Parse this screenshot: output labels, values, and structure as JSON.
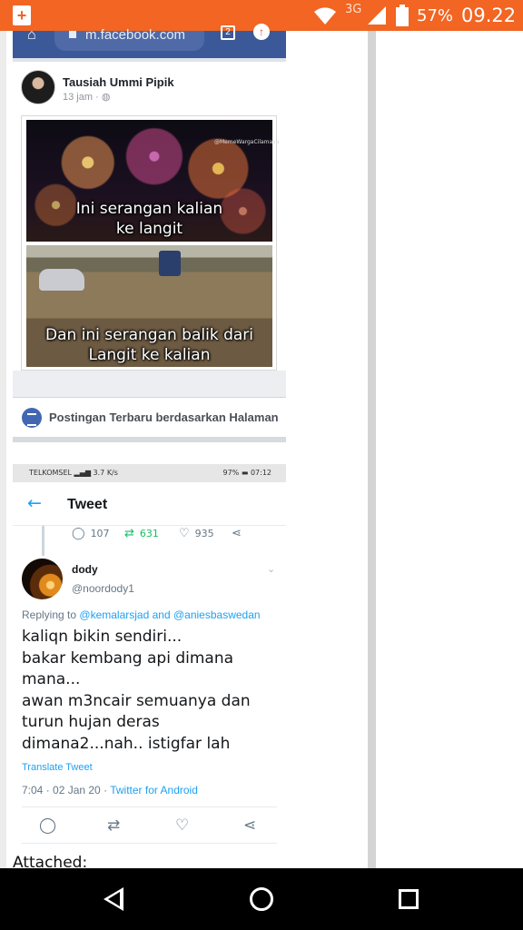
{
  "status_bar": {
    "network_type": "3G",
    "battery_percent": "57%",
    "time": "09.22"
  },
  "browser": {
    "url": "m.facebook.com",
    "tab_count": "2"
  },
  "post": {
    "author": "Tausiah Ummi Pipik",
    "time": "13 jam ·",
    "meme": {
      "watermark": "@MemeWargaCilamaya",
      "top_caption_line1": "Ini serangan kalian",
      "top_caption_line2": "ke langit",
      "bottom_caption_line1": "Dan ini serangan balik dari",
      "bottom_caption_line2": "Langit ke kalian"
    }
  },
  "recent_posts_label": "Postingan Terbaru berdasarkan Halaman",
  "tweet_screenshot": {
    "status": {
      "carrier": "TELKOMSEL",
      "speed": "3.7 K/s",
      "battery": "97%",
      "time": "07:12"
    },
    "header_title": "Tweet",
    "parent_stats": {
      "replies": "107",
      "retweets": "631",
      "likes": "935"
    },
    "author_name": "dody",
    "author_handle": "@noordody1",
    "replying_prefix": "Replying to",
    "mention_1": "@kemalarsjad",
    "replying_and": "and",
    "mention_2": "@aniesbaswedan",
    "body": "kaliqn bikin sendiri...\nbakar kembang api dimana mana...\nawan m3ncair semuanya dan turun hujan deras dimana2...nah.. istigfar lah",
    "translate_label": "Translate Tweet",
    "timestamp": "7:04 · 02 Jan 20 ·",
    "client": "Twitter for Android",
    "accent_color": "#1da1f2",
    "retweet_color": "#17bf63"
  },
  "attached_label": "Attached:",
  "colors": {
    "status_bar": "#f26522",
    "facebook_blue": "#3b5998"
  }
}
